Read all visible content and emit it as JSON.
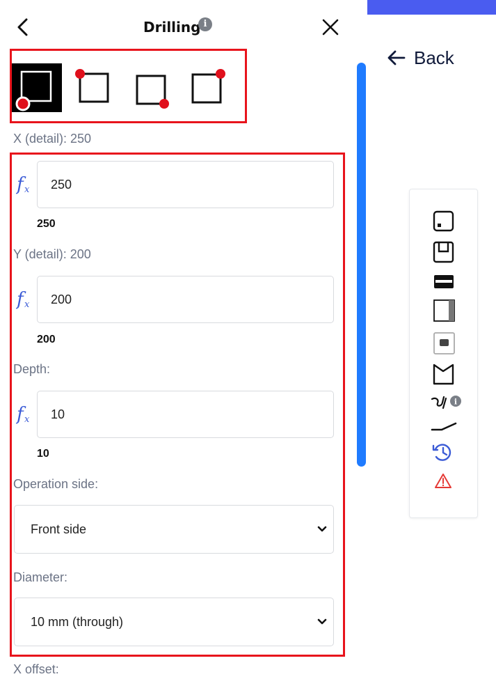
{
  "header": {
    "title": "Drilling",
    "info_glyph": "i",
    "back_icon": "chevron-left-icon",
    "close_icon": "close-icon"
  },
  "corner_options": [
    {
      "name": "corner-bottom-left",
      "selected": true
    },
    {
      "name": "corner-top-left",
      "selected": false
    },
    {
      "name": "corner-bottom-right",
      "selected": false
    },
    {
      "name": "corner-top-right",
      "selected": false
    }
  ],
  "fields": {
    "x": {
      "label": "X (detail): 250",
      "value": "250",
      "computed": "250"
    },
    "y": {
      "label": "Y (detail): 200",
      "value": "200",
      "computed": "200"
    },
    "depth": {
      "label": "Depth:",
      "value": "10",
      "computed": "10"
    },
    "operation_side": {
      "label": "Operation side:",
      "selected": "Front side"
    },
    "diameter": {
      "label": "Diameter:",
      "selected": "10 mm (through)"
    },
    "x_offset": {
      "label": "X offset:"
    }
  },
  "right_panel": {
    "back_label": "Back",
    "tools": [
      "panel-drill-icon",
      "groove-icon",
      "edge-band-icon",
      "side-panel-icon",
      "pocket-icon",
      "cutout-icon",
      "curve-tool-icon",
      "line-tool-icon",
      "history-icon",
      "warning-icon"
    ],
    "info_glyph": "i"
  },
  "colors": {
    "accent_blue": "#1f7bff",
    "highlight_red": "#e8141c",
    "corner_dot": "#e0101c",
    "top_bar": "#4a5cf0",
    "fx_blue": "#3b5bd6",
    "warning": "#e53935"
  }
}
